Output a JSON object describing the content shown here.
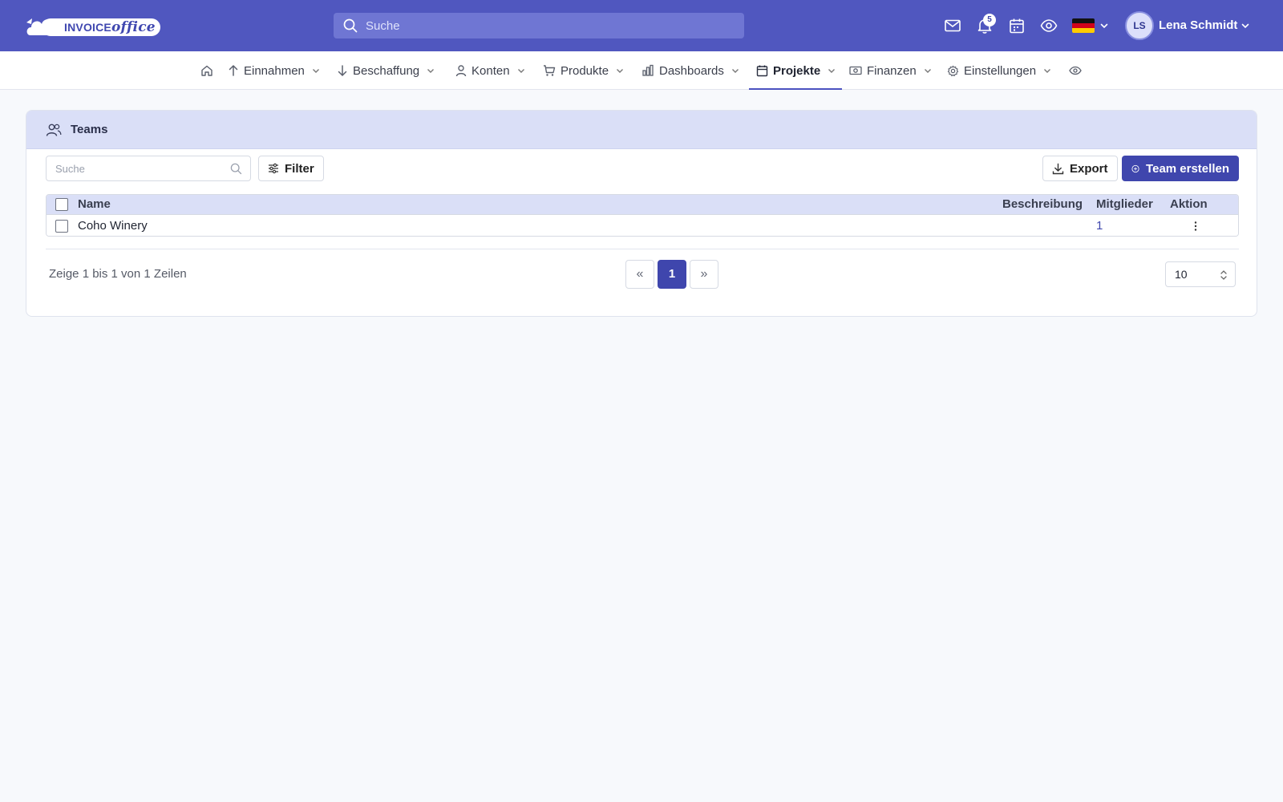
{
  "brand": {
    "logo_text": "INVOICE",
    "logo_suffix": "office"
  },
  "topbar": {
    "search_placeholder": "Suche",
    "notification_count": "5",
    "language_flag": "de",
    "user": {
      "initials": "LS",
      "name": "Lena Schmidt"
    }
  },
  "nav": {
    "items": [
      {
        "label": "Einnahmen",
        "icon": "arrow-up-icon"
      },
      {
        "label": "Beschaffung",
        "icon": "arrow-down-icon"
      },
      {
        "label": "Konten",
        "icon": "person-icon"
      },
      {
        "label": "Produkte",
        "icon": "cart-icon"
      },
      {
        "label": "Dashboards",
        "icon": "bar-chart-icon"
      },
      {
        "label": "Projekte",
        "icon": "calendar-icon",
        "active": true
      },
      {
        "label": "Finanzen",
        "icon": "money-icon"
      },
      {
        "label": "Einstellungen",
        "icon": "gear-icon"
      }
    ]
  },
  "card": {
    "title": "Teams",
    "search_placeholder": "Suche",
    "filter_label": "Filter",
    "export_label": "Export",
    "create_label": "Team erstellen",
    "table": {
      "columns": [
        "Name",
        "Beschreibung",
        "Mitglieder",
        "Aktion"
      ],
      "rows": [
        {
          "name": "Coho Winery",
          "description": "",
          "members": "1"
        }
      ]
    },
    "pagination": {
      "info": "Zeige 1 bis 1 von 1 Zeilen",
      "prev": "«",
      "current": "1",
      "next": "»",
      "page_size": "10"
    }
  },
  "colors": {
    "topbar": "#5057bf",
    "accent": "#3f46ad",
    "header_tint": "#dadff7",
    "background": "#f7f9fc"
  }
}
